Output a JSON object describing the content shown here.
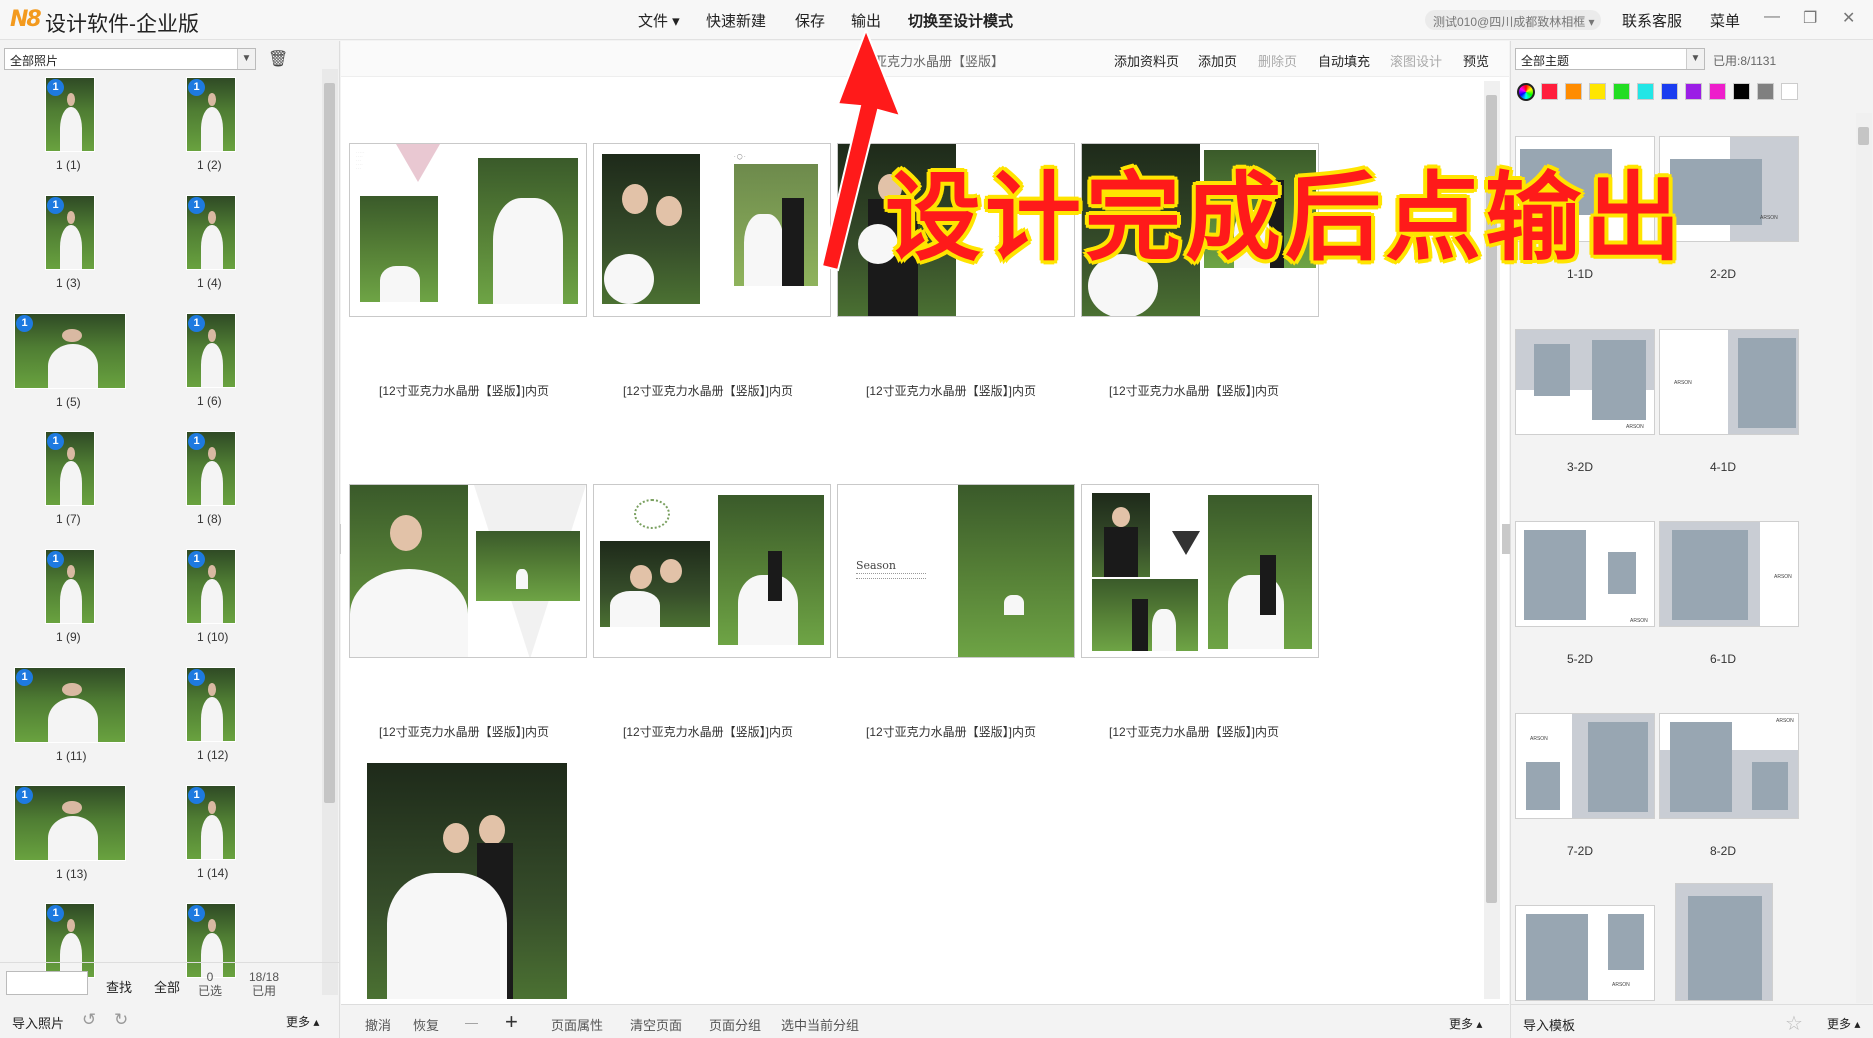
{
  "app": {
    "logo": "N8",
    "title": "设计软件-企业版"
  },
  "top_menu": {
    "file": "文件 ▾",
    "quick_new": "快速新建",
    "save": "保存",
    "output": "输出",
    "switch_mode": "切换至设计模式",
    "user": "测试010@四川成都致林相框 ▾",
    "contact": "联系客服",
    "menu": "菜单"
  },
  "left_panel": {
    "filter_select": "全部照片",
    "photos": [
      {
        "label": "1 (1)",
        "badge": "1"
      },
      {
        "label": "1 (2)",
        "badge": "1"
      },
      {
        "label": "1 (3)",
        "badge": "1"
      },
      {
        "label": "1 (4)",
        "badge": "1"
      },
      {
        "label": "1 (5)",
        "badge": "1"
      },
      {
        "label": "1 (6)",
        "badge": "1"
      },
      {
        "label": "1 (7)",
        "badge": "1"
      },
      {
        "label": "1 (8)",
        "badge": "1"
      },
      {
        "label": "1 (9)",
        "badge": "1"
      },
      {
        "label": "1 (10)",
        "badge": "1"
      },
      {
        "label": "1 (11)",
        "badge": "1"
      },
      {
        "label": "1 (12)",
        "badge": "1"
      },
      {
        "label": "1 (13)",
        "badge": "1"
      },
      {
        "label": "1 (14)",
        "badge": "1"
      },
      {
        "label": "",
        "badge": "1"
      },
      {
        "label": "",
        "badge": "1"
      }
    ],
    "search_button": "查找",
    "all_button": "全部",
    "selected_count": "0",
    "selected_label": "已选",
    "used_count": "18/18",
    "used_label": "已用",
    "import_photos": "导入照片",
    "more": "更多 ▴"
  },
  "center": {
    "title": "寸亚克力水晶册【竖版】",
    "toolbar": {
      "add_info_page": "添加资料页",
      "add_page": "添加页",
      "delete_page": "删除页",
      "auto_fill": "自动填充",
      "scroll_design": "滚图设计",
      "preview": "预览"
    },
    "page_caption": "[12寸亚克力水晶册【竖版】]内页",
    "footer": {
      "undo": "撤消",
      "redo": "恢复",
      "zoom_out": "—",
      "zoom_in": "+",
      "page_props": "页面属性",
      "clear_page": "清空页面",
      "page_group": "页面分组",
      "select_group": "选中当前分组",
      "more": "更多 ▴"
    }
  },
  "right_panel": {
    "theme_select": "全部主题",
    "used": "已用:8/1131",
    "colors": [
      "#ff1e3c",
      "#ff8c00",
      "#ffe600",
      "#22dd22",
      "#22e6e6",
      "#1a3cf0",
      "#9b1ee6",
      "#ee1ecb",
      "#000000",
      "#808080",
      "#ffffff"
    ],
    "templates": [
      "1-1D",
      "2-2D",
      "3-2D",
      "4-1D",
      "5-2D",
      "6-1D",
      "7-2D",
      "8-2D"
    ],
    "import_template": "导入模板",
    "more": "更多 ▴"
  },
  "annotation": {
    "text": "设计完成后点输出"
  }
}
